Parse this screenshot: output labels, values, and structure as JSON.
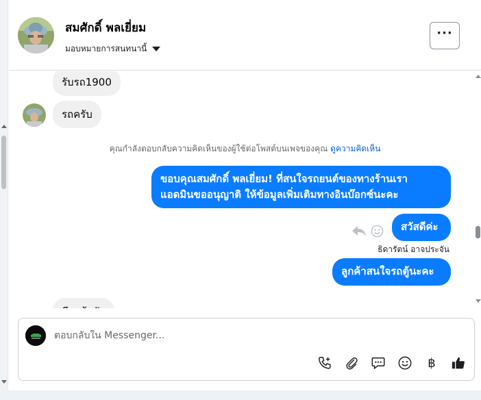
{
  "header": {
    "contact_name": "สมศักดิ์ พลเยี่ยม",
    "assign_label": "มอบหมายการสนทนานี้",
    "more_label": "···"
  },
  "messages": {
    "in_1": "รับรถ1900",
    "in_2": "รถครับ",
    "notice_text": "คุณกำลังตอบกลับความคิดเห็นของผู้ใช้ต่อโพสต์บนเพจของคุณ",
    "notice_link": "ดูความคิดเห็น",
    "out_1_line1": "ขอบคุณสมศักดิ์ พลเยี่ยม! ที่สนใจรถยนต์ของทางร้านเรา",
    "out_1_line2": "แอดมินขออนุญาติ ให้ข้อมูลเพิ่มเติมทางอินบ๊อกซ์นะคะ",
    "out_2": "สวัสดีค่ะ",
    "sender_name": "ธิดารัตน์ อาจประจัน",
    "out_3": "ลูกค้าสนใจรถตู้นะคะ",
    "in_3_partial": "มีรถตู้ครับ"
  },
  "composer": {
    "placeholder": "ตอบกลับใน Messenger...",
    "baht_symbol": "฿"
  },
  "icons": {
    "header": [
      "avatar",
      "chevron-down-icon",
      "more-icon"
    ],
    "tools": [
      "phone-plus-icon",
      "paperclip-icon",
      "chat-bubble-icon",
      "smiley-icon",
      "baht-icon",
      "thumbs-up-icon"
    ]
  },
  "colors": {
    "outgoing_bubble": "#0a7cff",
    "incoming_bubble": "#f0f0f0",
    "link": "#0064d1"
  }
}
